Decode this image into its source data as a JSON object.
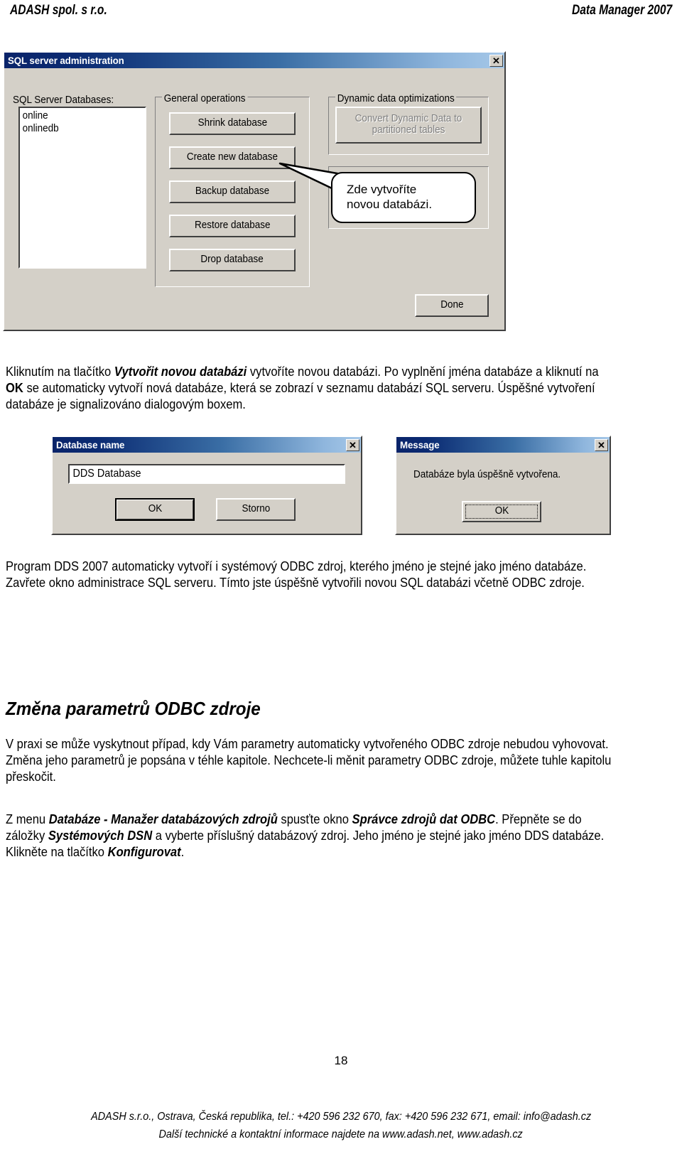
{
  "page_header": {
    "left": "ADASH spol. s r.o.",
    "right": "Data Manager 2007"
  },
  "sql_admin_dialog": {
    "title": "SQL server administration",
    "close_label": "✕",
    "databases_label": "SQL Server Databases:",
    "database_list": [
      "online",
      "onlinedb"
    ],
    "general_group_label": "General operations",
    "general_buttons": [
      "Shrink database",
      "Create new database",
      "Backup database",
      "Restore database",
      "Drop database"
    ],
    "dynamic_group_label": "Dynamic data optimizations",
    "dynamic_button": "Convert Dynamic Data to\npartitioned tables",
    "done_label": "Done"
  },
  "callout": {
    "line1": "Zde vytvoříte",
    "line2": "novou databázi."
  },
  "paragraph_1": {
    "run_1": "Kliknutím na tlačítko ",
    "run_2_bold_italic": "Vytvořit novou databázi",
    "run_3": " vytvoříte novou databázi. Po vyplnění jména databáze a kliknutí na ",
    "run_4_bold": "OK",
    "run_5": " se automaticky vytvoří nová databáze, která se zobrazí v seznamu databází SQL serveru. Úspěšné vytvoření databáze je signalizováno dialogovým boxem."
  },
  "database_name_dialog": {
    "title": "Database name",
    "close_label": "✕",
    "input_value": "DDS Database",
    "ok_label": "OK",
    "cancel_label": "Storno"
  },
  "message_dialog": {
    "title": "Message",
    "close_label": "✕",
    "body_text": "Databáze byla úspěšně vytvořena.",
    "ok_label": "OK"
  },
  "paragraph_2": {
    "text": "Program DDS 2007 automaticky vytvoří i systémový ODBC zdroj, kterého jméno je stejné jako jméno databáze. Zavřete okno administrace SQL serveru. Tímto jste úspěšně vytvořili novou SQL databázi včetně ODBC zdroje."
  },
  "section_heading": "Změna parametrů ODBC zdroje",
  "paragraph_3": {
    "text": "V praxi se může vyskytnout případ, kdy Vám parametry automaticky vytvořeného ODBC zdroje nebudou vyhovovat. Změna jeho parametrů je popsána v téhle kapitole. Nechcete-li měnit parametry ODBC zdroje, můžete tuhle kapitolu přeskočit."
  },
  "paragraph_4": {
    "run_1": "Z menu ",
    "run_2_bold_italic": "Databáze - Manažer databázových zdrojů",
    "run_3": " spusťte okno ",
    "run_4_bold_italic": "Správce zdrojů dat ODBC",
    "run_5": ". Přepněte se do záložky ",
    "run_6_bold_italic": "Systémových DSN",
    "run_7": " a vyberte příslušný databázový zdroj. Jeho jméno je stejné jako jméno DDS databáze. Klikněte na tlačítko ",
    "run_8_bold_italic": "Konfigurovat",
    "run_9": "."
  },
  "footer": {
    "page_number": "18",
    "line1": "ADASH s.r.o., Ostrava, Česká republika, tel.: +420 596 232 670, fax: +420 596 232 671, email: info@adash.cz",
    "line2": "Další technické a kontaktní informace najdete na www.adash.net, www.adash.cz"
  },
  "colors": {
    "dialog_face": "#d4d0c8",
    "titlebar_start": "#0a246a",
    "titlebar_end": "#a6c8e8",
    "text": "#000000"
  }
}
